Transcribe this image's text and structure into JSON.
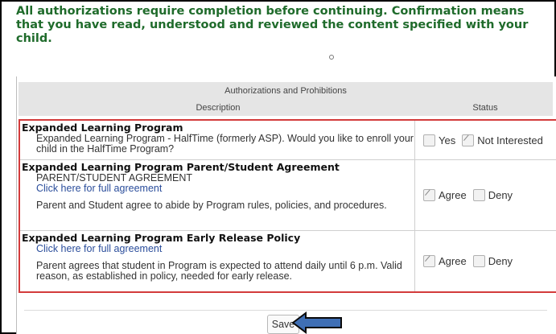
{
  "instructions": "All authorizations require completion before continuing. Confirmation means that you have read, understood and reviewed the content specified with your child.",
  "table": {
    "header_title": "Authorizations and Prohibitions",
    "col_description": "Description",
    "col_status": "Status"
  },
  "rows": [
    {
      "title": "Expanded Learning Program",
      "text": "Expanded Learning Program - HalfTime (formerly ASP). Would you like to enroll your child in the HalfTime Program?",
      "options": [
        {
          "label": "Yes",
          "checked": false
        },
        {
          "label": "Not Interested",
          "checked": true
        }
      ]
    },
    {
      "title": "Expanded Learning Program Parent/Student Agreement",
      "subtitle": "PARENT/STUDENT AGREEMENT",
      "link": "Click here for full agreement",
      "text": "Parent and Student agree to abide by Program rules, policies, and procedures.",
      "options": [
        {
          "label": "Agree",
          "checked": true
        },
        {
          "label": "Deny",
          "checked": false
        }
      ]
    },
    {
      "title": "Expanded Learning Program Early Release Policy",
      "link": "Click here for full agreement",
      "text": "Parent agrees that student in Program is expected to attend daily until 6 p.m. Valid reason, as established in policy, needed for early release.",
      "options": [
        {
          "label": "Agree",
          "checked": true
        },
        {
          "label": "Deny",
          "checked": false
        }
      ]
    }
  ],
  "save_label": "Save",
  "colors": {
    "instruction_green": "#1f6b2b",
    "highlight_border": "#d33b3b",
    "link_blue": "#2a4d9b",
    "arrow_fill": "#3f6fb5"
  }
}
